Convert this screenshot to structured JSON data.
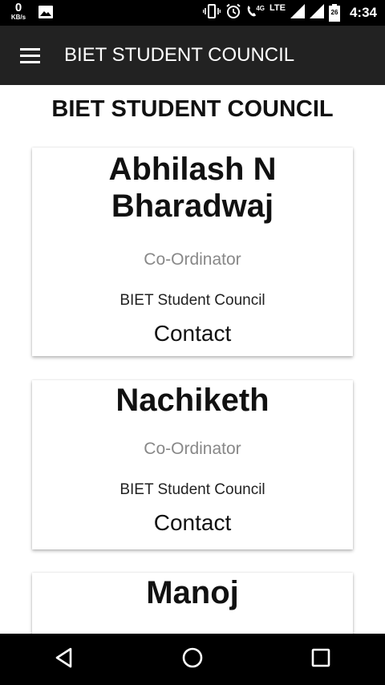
{
  "status_bar": {
    "net_speed_value": "0",
    "net_speed_unit": "KB/s",
    "network_type": "4G",
    "lte_label": "LTE",
    "battery_level": "26",
    "time": "4:34"
  },
  "app_bar": {
    "title": "BIET STUDENT COUNCIL"
  },
  "page": {
    "heading": "BIET STUDENT COUNCIL"
  },
  "cards": [
    {
      "name_line1": "Abhilash N",
      "name_line2": "Bharadwaj",
      "role": "Co-Ordinator",
      "org": "BIET Student Council",
      "contact_label": "Contact"
    },
    {
      "name": "Nachiketh",
      "role": "Co-Ordinator",
      "org": "BIET Student Council",
      "contact_label": "Contact"
    },
    {
      "name": "Manoj"
    }
  ],
  "icons": {
    "menu": "hamburger-menu-icon",
    "back": "back-triangle-icon",
    "home": "home-circle-icon",
    "recents": "recents-square-icon"
  }
}
